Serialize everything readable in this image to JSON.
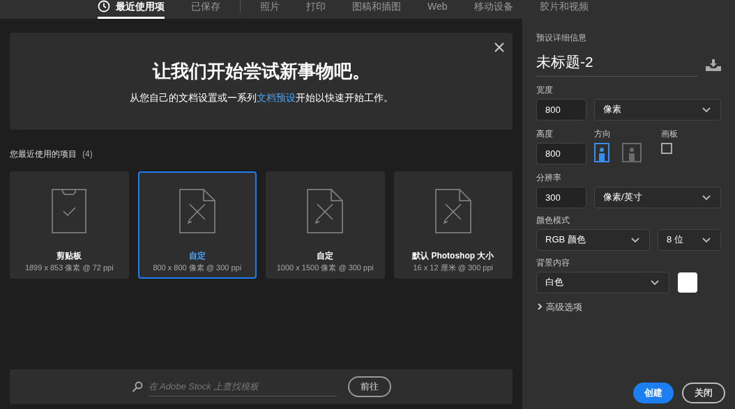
{
  "tabs": [
    {
      "label": "最近使用项",
      "selected": true,
      "kind": "recent"
    },
    {
      "label": "已保存",
      "selected": false
    },
    {
      "label": "照片",
      "selected": false
    },
    {
      "label": "打印",
      "selected": false
    },
    {
      "label": "图稿和插图",
      "selected": false
    },
    {
      "label": "Web",
      "selected": false
    },
    {
      "label": "移动设备",
      "selected": false
    },
    {
      "label": "胶片和视频",
      "selected": false
    }
  ],
  "banner": {
    "title": "让我们开始尝试新事物吧。",
    "subtitle": {
      "before": "从您自己的文档设置或一系列",
      "link": "文档预设",
      "after": "开始以快速开始工作。"
    }
  },
  "recent": {
    "heading": "您最近使用的项目",
    "count": "(4)",
    "items": [
      {
        "kind": "clipboard",
        "name": "剪贴板",
        "details": "1899 x 853 像素 @ 72 ppi",
        "selected": false
      },
      {
        "kind": "document",
        "name": "自定",
        "details": "800 x 800 像素 @ 300 ppi",
        "selected": true
      },
      {
        "kind": "document",
        "name": "自定",
        "details": "1000 x 1500 像素 @ 300 ppi",
        "selected": false
      },
      {
        "kind": "document",
        "name": "默认 Photoshop 大小",
        "details": "16 x 12 厘米 @ 300 ppi",
        "selected": false
      }
    ]
  },
  "stock_search": {
    "placeholder": "在 Adobe Stock 上查找模板",
    "button": "前往"
  },
  "preset": {
    "heading": "预设详细信息",
    "name": "未标题-2",
    "width": {
      "label": "宽度",
      "value": "800",
      "unit": "像素"
    },
    "height": {
      "label": "高度",
      "value": "800"
    },
    "orientation": {
      "label": "方向",
      "options": [
        {
          "kind": "portrait",
          "selected": true
        },
        {
          "kind": "landscape",
          "selected": false
        }
      ]
    },
    "artboard": {
      "label": "画板",
      "checked": false
    },
    "resolution": {
      "label": "分辨率",
      "value": "300",
      "unit": "像素/英寸"
    },
    "color_mode": {
      "label": "颜色模式",
      "mode": "RGB 颜色",
      "depth": "8 位"
    },
    "background": {
      "label": "背景内容",
      "value": "白色",
      "color": "#ffffff"
    },
    "advanced": {
      "label": "高级选项",
      "expanded": false
    }
  },
  "buttons": [
    {
      "label": "创建",
      "kind": "primary"
    },
    {
      "label": "关闭",
      "kind": "secondary"
    }
  ]
}
